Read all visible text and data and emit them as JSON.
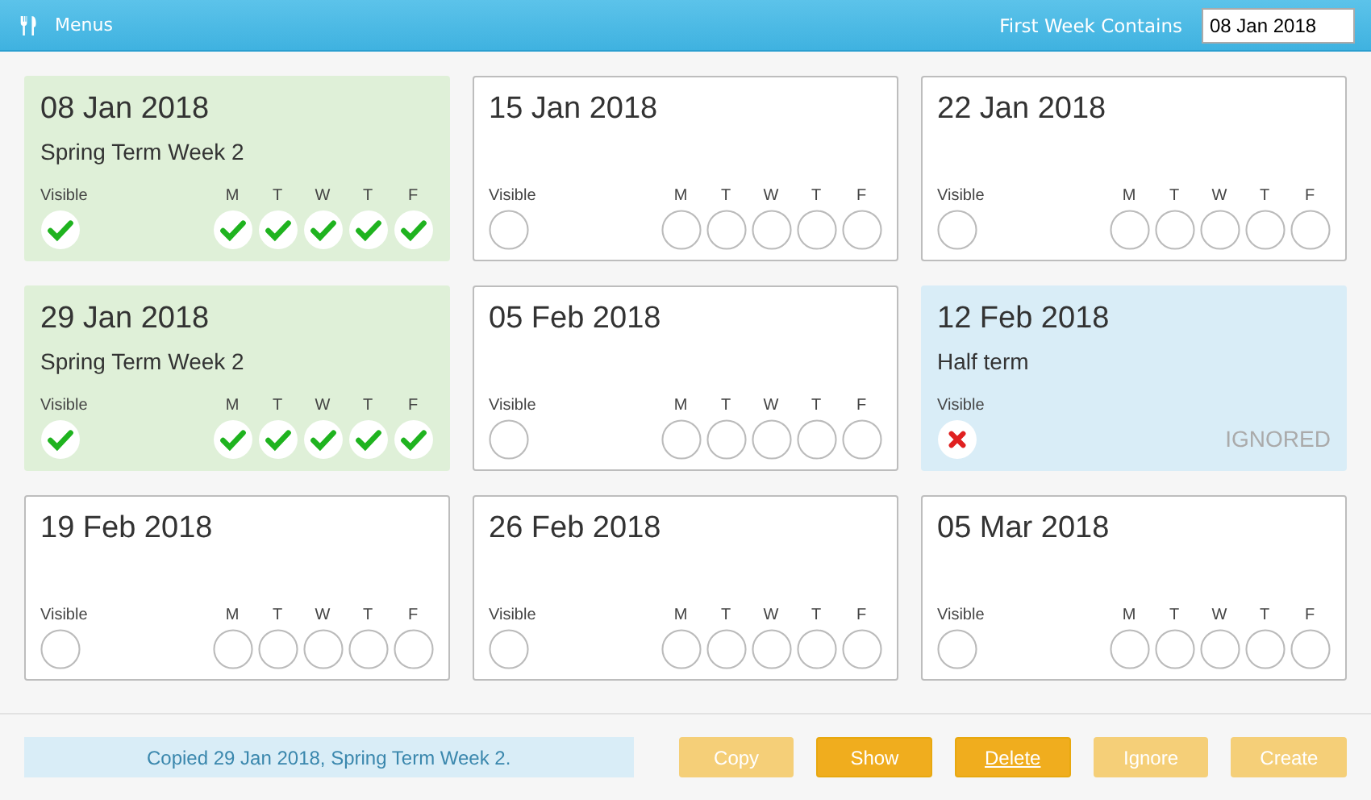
{
  "header": {
    "title": "Menus",
    "first_week_label": "First Week Contains",
    "first_week_value": "08 Jan 2018"
  },
  "weeks": [
    {
      "date": "08 Jan 2018",
      "name": "Spring Term Week 2",
      "kind": "active",
      "visible_label": "Visible",
      "visible": true,
      "days": [
        {
          "label": "M",
          "checked": true
        },
        {
          "label": "T",
          "checked": true
        },
        {
          "label": "W",
          "checked": true
        },
        {
          "label": "T",
          "checked": true
        },
        {
          "label": "F",
          "checked": true
        }
      ]
    },
    {
      "date": "15 Jan 2018",
      "kind": "empty",
      "visible_label": "Visible",
      "visible": false,
      "days": [
        {
          "label": "M",
          "checked": false
        },
        {
          "label": "T",
          "checked": false
        },
        {
          "label": "W",
          "checked": false
        },
        {
          "label": "T",
          "checked": false
        },
        {
          "label": "F",
          "checked": false
        }
      ]
    },
    {
      "date": "22 Jan 2018",
      "kind": "empty",
      "visible_label": "Visible",
      "visible": false,
      "days": [
        {
          "label": "M",
          "checked": false
        },
        {
          "label": "T",
          "checked": false
        },
        {
          "label": "W",
          "checked": false
        },
        {
          "label": "T",
          "checked": false
        },
        {
          "label": "F",
          "checked": false
        }
      ]
    },
    {
      "date": "29 Jan 2018",
      "name": "Spring Term Week 2",
      "kind": "active",
      "visible_label": "Visible",
      "visible": true,
      "days": [
        {
          "label": "M",
          "checked": true
        },
        {
          "label": "T",
          "checked": true
        },
        {
          "label": "W",
          "checked": true
        },
        {
          "label": "T",
          "checked": true
        },
        {
          "label": "F",
          "checked": true
        }
      ]
    },
    {
      "date": "05 Feb 2018",
      "kind": "empty",
      "visible_label": "Visible",
      "visible": false,
      "days": [
        {
          "label": "M",
          "checked": false
        },
        {
          "label": "T",
          "checked": false
        },
        {
          "label": "W",
          "checked": false
        },
        {
          "label": "T",
          "checked": false
        },
        {
          "label": "F",
          "checked": false
        }
      ]
    },
    {
      "date": "12 Feb 2018",
      "name": "Half term",
      "kind": "ignored",
      "visible_label": "Visible",
      "visible": false,
      "status_label": "IGNORED"
    },
    {
      "date": "19 Feb 2018",
      "kind": "empty",
      "visible_label": "Visible",
      "visible": false,
      "days": [
        {
          "label": "M",
          "checked": false
        },
        {
          "label": "T",
          "checked": false
        },
        {
          "label": "W",
          "checked": false
        },
        {
          "label": "T",
          "checked": false
        },
        {
          "label": "F",
          "checked": false
        }
      ]
    },
    {
      "date": "26 Feb 2018",
      "kind": "empty",
      "visible_label": "Visible",
      "visible": false,
      "days": [
        {
          "label": "M",
          "checked": false
        },
        {
          "label": "T",
          "checked": false
        },
        {
          "label": "W",
          "checked": false
        },
        {
          "label": "T",
          "checked": false
        },
        {
          "label": "F",
          "checked": false
        }
      ]
    },
    {
      "date": "05 Mar 2018",
      "kind": "empty",
      "visible_label": "Visible",
      "visible": false,
      "days": [
        {
          "label": "M",
          "checked": false
        },
        {
          "label": "T",
          "checked": false
        },
        {
          "label": "W",
          "checked": false
        },
        {
          "label": "T",
          "checked": false
        },
        {
          "label": "F",
          "checked": false
        }
      ]
    }
  ],
  "footer": {
    "message": "Copied 29 Jan 2018, Spring Term Week 2.",
    "buttons": [
      {
        "label": "Copy",
        "disabled": true,
        "focused": false
      },
      {
        "label": "Show",
        "disabled": false,
        "focused": false
      },
      {
        "label": "Delete",
        "disabled": false,
        "focused": true
      },
      {
        "label": "Ignore",
        "disabled": true,
        "focused": false
      },
      {
        "label": "Create",
        "disabled": true,
        "focused": false
      }
    ]
  }
}
